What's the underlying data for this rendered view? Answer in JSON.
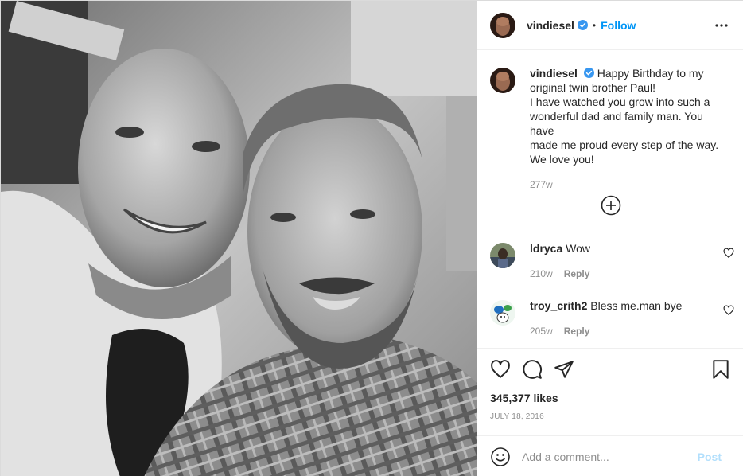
{
  "post": {
    "username": "vindiesel",
    "follow_label": "Follow",
    "separator": "•",
    "caption_lines": [
      "Happy Birthday to my",
      "original twin brother Paul!",
      "I have watched you grow into such a",
      "wonderful dad and family man. You have",
      "made me proud every step of the way.",
      "We love you!"
    ],
    "caption_time": "277w",
    "photo_alt": "Two men smiling in a black and white selfie"
  },
  "comments": [
    {
      "username": "ldryca",
      "text": "Wow",
      "time": "210w",
      "reply_label": "Reply"
    },
    {
      "username": "troy_crith2",
      "text": "Bless me.man bye",
      "time": "205w",
      "reply_label": "Reply"
    }
  ],
  "stats": {
    "likes": "345,377 likes",
    "date": "JULY 18, 2016"
  },
  "add_comment": {
    "placeholder": "Add a comment...",
    "post_label": "Post"
  },
  "icons": {
    "verified": "verified-badge-icon",
    "more": "more-options-icon",
    "load_more": "load-more-comments-icon",
    "heart": "heart-icon",
    "comment": "comment-icon",
    "share": "share-icon",
    "save": "bookmark-icon",
    "emoji": "emoji-icon"
  },
  "colors": {
    "accent": "#0095f6",
    "verified": "#3897f0",
    "muted": "#8e8e8e",
    "post_disabled": "#b2dffc",
    "border": "#efefef"
  }
}
